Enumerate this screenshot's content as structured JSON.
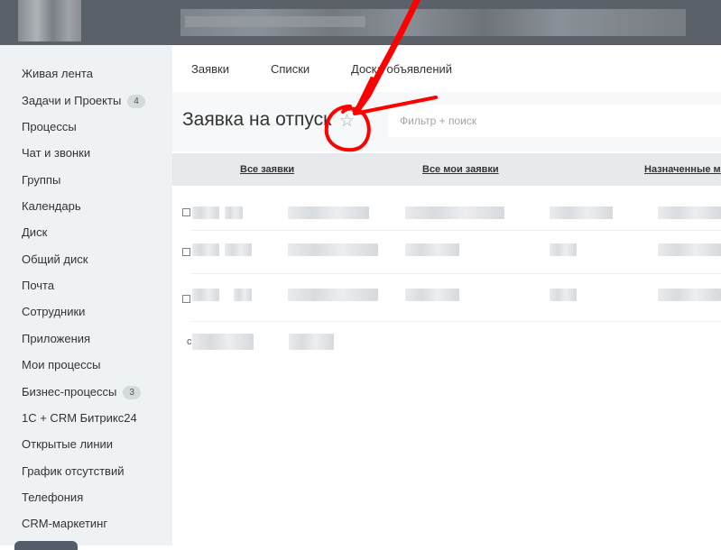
{
  "sidebar": {
    "items": [
      {
        "label": "Живая лента"
      },
      {
        "label": "Задачи и Проекты",
        "counter": "4"
      },
      {
        "label": "Процессы"
      },
      {
        "label": "Чат и звонки"
      },
      {
        "label": "Группы"
      },
      {
        "label": "Календарь"
      },
      {
        "label": "Диск"
      },
      {
        "label": "Общий диск"
      },
      {
        "label": "Почта"
      },
      {
        "label": "Сотрудники"
      },
      {
        "label": "Приложения"
      },
      {
        "label": "Мои процессы"
      },
      {
        "label": "Бизнес-процессы",
        "counter": "3"
      },
      {
        "label": "1С + CRM Битрикс24"
      },
      {
        "label": "Открытые линии"
      },
      {
        "label": "График отсутствий"
      },
      {
        "label": "Телефония"
      },
      {
        "label": "CRM-маркетинг"
      }
    ]
  },
  "topnav": {
    "items": [
      "Заявки",
      "Списки",
      "Доска объявлений"
    ]
  },
  "page": {
    "title": "Заявка на отпуск",
    "star_icon": "☆"
  },
  "search": {
    "placeholder": "Фильтр + поиск"
  },
  "grid": {
    "columns": [
      "Все заявки",
      "Все мои заявки",
      "Назначенные м"
    ],
    "footer_letter": "с"
  },
  "colors": {
    "header_bg": "#5b6168",
    "sidebar_bg": "#eef2f4",
    "grid_header_bg": "#e6eaec",
    "annotation": "#ff0000"
  }
}
